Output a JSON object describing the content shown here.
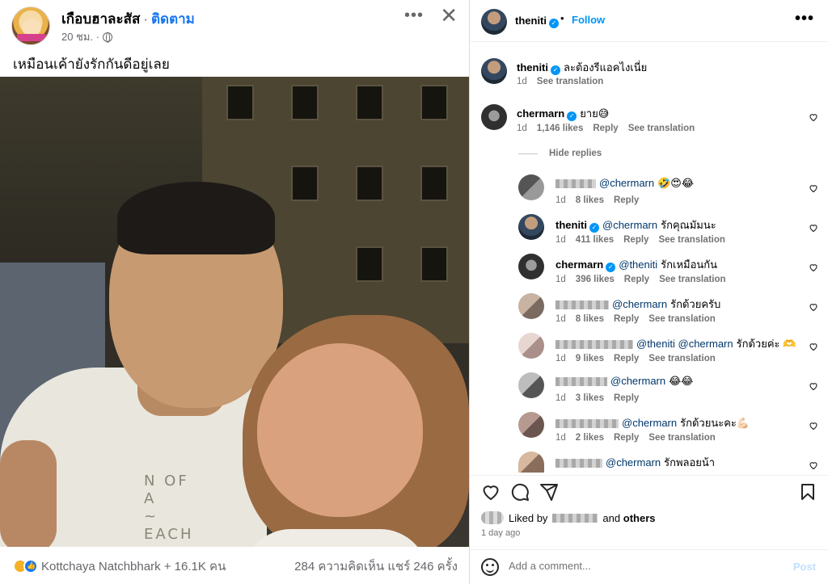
{
  "facebook": {
    "page_name": "เกือบฮาละสัส",
    "separator": "·",
    "follow_label": "ติดตาม",
    "time": "20 ชม. ·",
    "caption": "เหมือนเค้ายังรักกันดีอยู่เลย",
    "shirt_print": "N OF\nA\n~\nEACH",
    "reactions_text": "Kottchaya Natchbhark + 16.1K คน",
    "stats_text": "284 ความคิดเห็น  แชร์ 246 ครั้ง",
    "icons": {
      "more": "more-icon",
      "close": "close-icon",
      "audience": "globe-icon"
    }
  },
  "instagram": {
    "header": {
      "username": "theniti",
      "dot": "•",
      "follow_label": "Follow",
      "more_label": "•••"
    },
    "caption": {
      "username": "theniti",
      "text": "ละต้องรีแอคไงเนี่ย",
      "time": "1d",
      "see_translation": "See translation"
    },
    "comments": [
      {
        "username": "chermarn",
        "verified": true,
        "text": "ยาย😅",
        "time": "1d",
        "likes": "1,146 likes",
        "reply": "Reply",
        "translate": "See translation"
      }
    ],
    "hide_replies_label": "Hide replies",
    "replies": [
      {
        "username": "",
        "blurred": true,
        "mention": "@chermarn",
        "text": "🤣😍😂",
        "time": "1d",
        "likes": "8 likes",
        "reply": "Reply",
        "translate": ""
      },
      {
        "username": "theniti",
        "verified": true,
        "mention": "@chermarn",
        "text": "รักคุณมัมนะ",
        "time": "1d",
        "likes": "411 likes",
        "reply": "Reply",
        "translate": "See translation"
      },
      {
        "username": "chermarn",
        "verified": true,
        "mention": "@theniti",
        "text": "รักเหมือนกัน",
        "time": "1d",
        "likes": "396 likes",
        "reply": "Reply",
        "translate": "See translation"
      },
      {
        "username": "",
        "blurred": true,
        "mention": "@chermarn",
        "text": "รักด้วยครับ",
        "time": "1d",
        "likes": "8 likes",
        "reply": "Reply",
        "translate": "See translation"
      },
      {
        "username": "",
        "blurred": true,
        "mention": "@theniti @chermarn",
        "text": "รักด้วยค่ะ 🫶",
        "time": "1d",
        "likes": "9 likes",
        "reply": "Reply",
        "translate": "See translation"
      },
      {
        "username": "",
        "blurred": true,
        "mention": "@chermarn",
        "text": "😂😂",
        "time": "1d",
        "likes": "3 likes",
        "reply": "Reply",
        "translate": ""
      },
      {
        "username": "",
        "blurred": true,
        "mention": "@chermarn",
        "text": "รักด้วยนะคะ💪🏻",
        "time": "1d",
        "likes": "2 likes",
        "reply": "Reply",
        "translate": "See translation"
      },
      {
        "username": "",
        "blurred": true,
        "mention": "@chermarn",
        "text": "รักพลอยน้า",
        "time": "",
        "likes": "",
        "reply": "",
        "translate": ""
      }
    ],
    "liked_by": {
      "prefix": "Liked by",
      "and": "and",
      "others": "others"
    },
    "posted": "1 day ago",
    "comment_placeholder": "Add a comment...",
    "post_label": "Post",
    "icons": {
      "like": "heart-icon",
      "comment": "comment-icon",
      "share": "share-icon",
      "save": "bookmark-icon",
      "emoji": "emoji-icon"
    },
    "colors": {
      "link": "#0095f6",
      "mention": "#00376b",
      "meta": "#737373"
    }
  }
}
